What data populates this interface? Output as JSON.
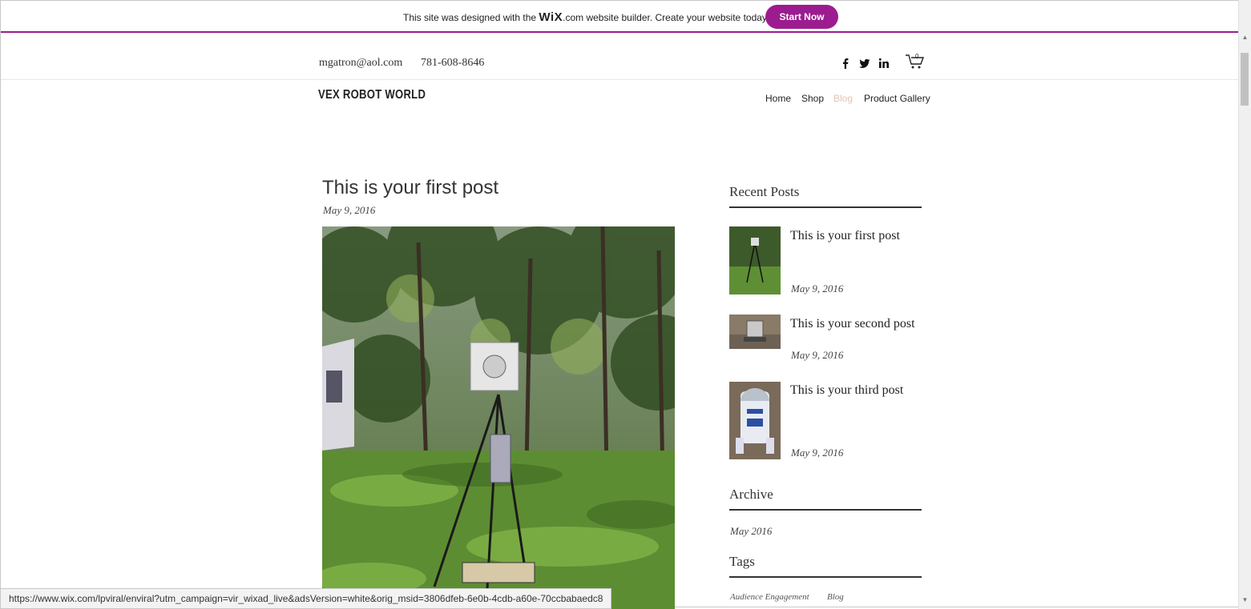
{
  "banner": {
    "prefix": "This site was designed with the ",
    "logo": "WiX",
    "suffix": ".com website builder. Create your website today.",
    "button_label": "Start Now"
  },
  "contact": {
    "email": "mgatron@aol.com",
    "phone": "781-608-8646"
  },
  "social_icons": [
    "facebook-icon",
    "twitter-icon",
    "linkedin-icon"
  ],
  "cart": {
    "count": "0"
  },
  "header": {
    "site_title": "VEX ROBOT WORLD",
    "nav": [
      {
        "label": "Home",
        "active": false
      },
      {
        "label": "Shop",
        "active": false
      },
      {
        "label": "Blog",
        "active": true
      },
      {
        "label": "Product Gallery",
        "active": false
      }
    ]
  },
  "post": {
    "title": "This is your first post",
    "date": "May 9, 2016"
  },
  "sidebar": {
    "recent_heading": "Recent Posts",
    "recent_posts": [
      {
        "title": "This is your first post",
        "date": "May 9, 2016"
      },
      {
        "title": "This is your second post",
        "date": "May 9, 2016"
      },
      {
        "title": "This is your third post",
        "date": "May 9, 2016"
      }
    ],
    "archive_heading": "Archive",
    "archive_items": [
      "May 2016"
    ],
    "tags_heading": "Tags",
    "tags": [
      "Audience Engagement",
      "Blog"
    ]
  },
  "status_bar": {
    "url": "https://www.wix.com/lpviral/enviral?utm_campaign=vir_wixad_live&adsVersion=white&orig_msid=3806dfeb-6e0b-4cdb-a60e-70ccbabaedc8"
  },
  "colors": {
    "wix_accent": "#9c1c8f",
    "nav_active": "#e3c6b3"
  }
}
